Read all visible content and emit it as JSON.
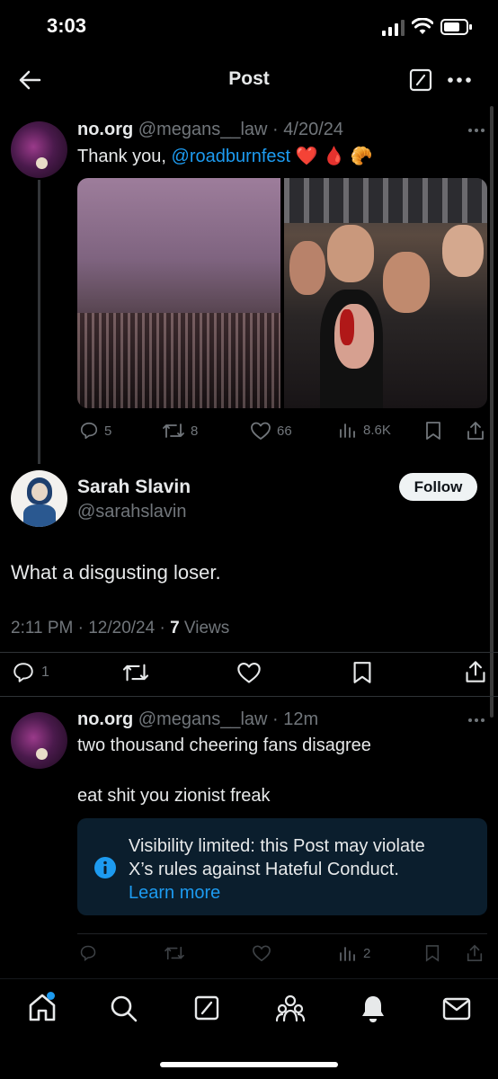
{
  "status_bar": {
    "time": "3:03"
  },
  "header": {
    "title": "Post"
  },
  "parent_post": {
    "display_name": "no.org",
    "handle_time": "@megans__law · 4/20/24",
    "text_prefix": "Thank you, ",
    "mention": "@roadburnfest",
    "emojis": "❤️ 🩸 🥐",
    "metrics": {
      "replies": "5",
      "reposts": "8",
      "likes": "66",
      "views": "8.6K"
    }
  },
  "main_post": {
    "display_name": "Sarah Slavin",
    "handle": "@sarahslavin",
    "follow_label": "Follow",
    "text": "What a disgusting loser.",
    "timestamp": "2:11 PM · 12/20/24 · ",
    "views_count": "7",
    "views_label": " Views",
    "metrics": {
      "replies": "1"
    }
  },
  "reply_post": {
    "display_name": "no.org",
    "handle_time": "@megans__law · 12m",
    "text_line1": "two thousand cheering fans disagree",
    "text_line2": "eat shit you zionist freak",
    "notice_text_line1": "Visibility limited: this Post may violate",
    "notice_text_line2": "X’s rules against Hateful Conduct.",
    "notice_link": "Learn more",
    "metrics": {
      "views": "2"
    }
  },
  "colors": {
    "accent": "#1d9bf0",
    "muted": "#71767b",
    "notice_bg": "#0b1e2d"
  }
}
